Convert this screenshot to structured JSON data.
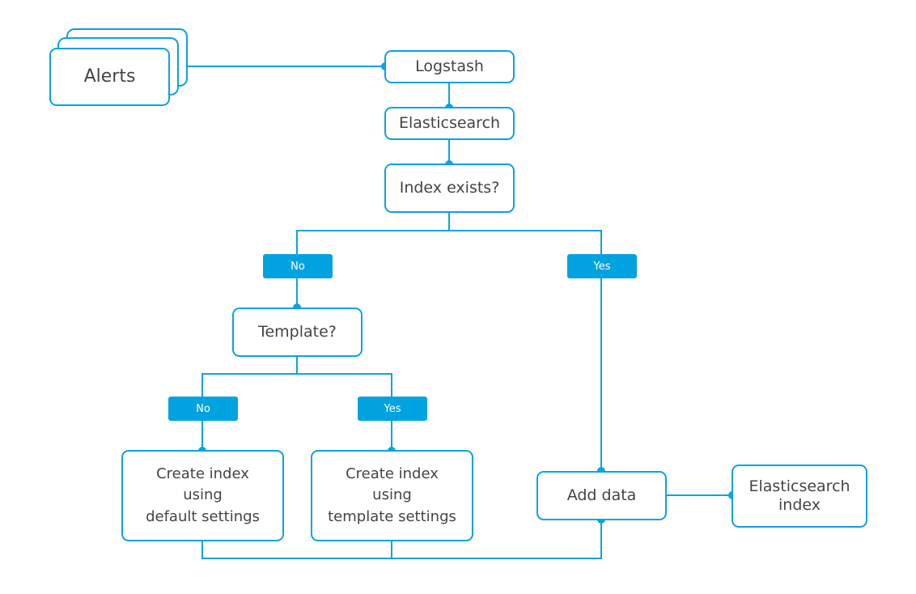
{
  "diagram": {
    "accent_color": "#00a3e0",
    "text_color": "#444444",
    "nodes": {
      "alerts": "Alerts",
      "logstash": "Logstash",
      "elasticsearch": "Elasticsearch",
      "index_exists": "Index exists?",
      "template": "Template?",
      "create_default": "Create index\nusing\ndefault settings",
      "create_template": "Create index\nusing\ntemplate settings",
      "add_data": "Add data",
      "es_index": "Elasticsearch\nindex"
    },
    "labels": {
      "index_no": "No",
      "index_yes": "Yes",
      "template_no": "No",
      "template_yes": "Yes"
    },
    "edges": [
      {
        "from": "alerts",
        "to": "logstash"
      },
      {
        "from": "logstash",
        "to": "elasticsearch"
      },
      {
        "from": "elasticsearch",
        "to": "index_exists"
      },
      {
        "from": "index_exists",
        "to": "template",
        "label": "No"
      },
      {
        "from": "index_exists",
        "to": "add_data",
        "label": "Yes"
      },
      {
        "from": "template",
        "to": "create_default",
        "label": "No"
      },
      {
        "from": "template",
        "to": "create_template",
        "label": "Yes"
      },
      {
        "from": "create_default",
        "to": "add_data"
      },
      {
        "from": "create_template",
        "to": "add_data"
      },
      {
        "from": "add_data",
        "to": "es_index"
      }
    ]
  }
}
